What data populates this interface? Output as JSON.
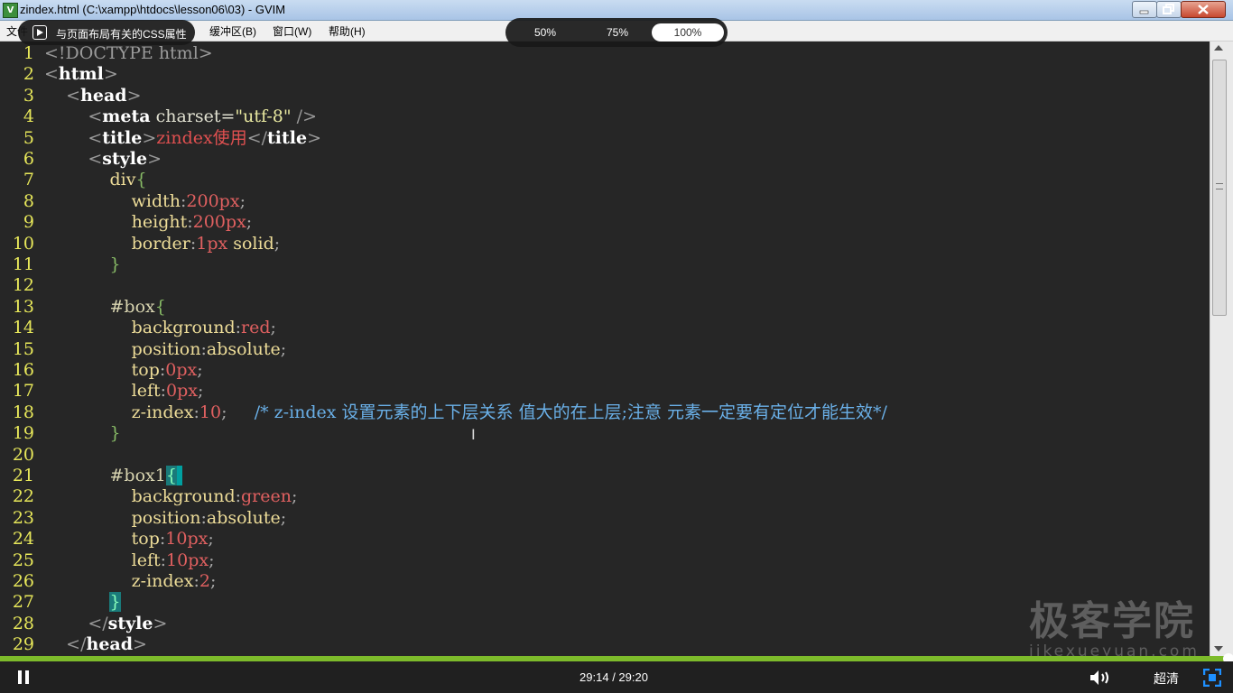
{
  "window": {
    "title": "zindex.html (C:\\xampp\\htdocs\\lesson06\\03) - GVIM",
    "app_icon": "vim-icon"
  },
  "menubar": {
    "items": [
      {
        "label": "文件"
      },
      {
        "label": "缓冲区(B)"
      },
      {
        "label": "窗口(W)"
      },
      {
        "label": "帮助(H)"
      }
    ]
  },
  "overlay": {
    "chapter": {
      "label": "与页面布局有关的CSS属性",
      "icon": "play-icon"
    },
    "zoom": {
      "options": [
        "50%",
        "75%",
        "100%"
      ],
      "selected": "100%"
    }
  },
  "editor": {
    "lines": [
      {
        "n": "1",
        "tokens": [
          [
            "<",
            "t-br"
          ],
          [
            "!DOCTYPE html",
            "t-br"
          ],
          [
            ">",
            "t-br"
          ]
        ]
      },
      {
        "n": "2",
        "tokens": [
          [
            "<",
            "t-br"
          ],
          [
            "html",
            "t-tag"
          ],
          [
            ">",
            "t-br"
          ]
        ]
      },
      {
        "n": "3",
        "tokens": [
          [
            "    ",
            ""
          ],
          [
            "<",
            "t-br"
          ],
          [
            "head",
            "t-tag"
          ],
          [
            ">",
            "t-br"
          ]
        ]
      },
      {
        "n": "4",
        "tokens": [
          [
            "        ",
            ""
          ],
          [
            "<",
            "t-br"
          ],
          [
            "meta",
            "t-tag"
          ],
          [
            " charset=",
            "t-attr"
          ],
          [
            "\"utf-8\"",
            "t-str"
          ],
          [
            " />",
            "t-br"
          ]
        ]
      },
      {
        "n": "5",
        "tokens": [
          [
            "        ",
            ""
          ],
          [
            "<",
            "t-br"
          ],
          [
            "title",
            "t-tag"
          ],
          [
            ">",
            "t-br"
          ],
          [
            "zindex使用",
            "t-title"
          ],
          [
            "</",
            "t-br"
          ],
          [
            "title",
            "t-tag"
          ],
          [
            ">",
            "t-br"
          ]
        ]
      },
      {
        "n": "6",
        "tokens": [
          [
            "        ",
            ""
          ],
          [
            "<",
            "t-br"
          ],
          [
            "style",
            "t-tag"
          ],
          [
            ">",
            "t-br"
          ]
        ]
      },
      {
        "n": "7",
        "tokens": [
          [
            "            ",
            ""
          ],
          [
            "div",
            "t-prop"
          ],
          [
            "{",
            "t-brace"
          ]
        ]
      },
      {
        "n": "8",
        "tokens": [
          [
            "                ",
            ""
          ],
          [
            "width",
            "t-prop"
          ],
          [
            ":",
            "t-punc"
          ],
          [
            "200px",
            "t-val"
          ],
          [
            ";",
            "t-punc"
          ]
        ]
      },
      {
        "n": "9",
        "tokens": [
          [
            "                ",
            ""
          ],
          [
            "height",
            "t-prop"
          ],
          [
            ":",
            "t-punc"
          ],
          [
            "200px",
            "t-val"
          ],
          [
            ";",
            "t-punc"
          ]
        ]
      },
      {
        "n": "10",
        "tokens": [
          [
            "                ",
            ""
          ],
          [
            "border",
            "t-prop"
          ],
          [
            ":",
            "t-punc"
          ],
          [
            "1px",
            "t-val"
          ],
          [
            " solid",
            "t-prop"
          ],
          [
            ";",
            "t-punc"
          ]
        ]
      },
      {
        "n": "11",
        "tokens": [
          [
            "            ",
            ""
          ],
          [
            "}",
            "t-brace"
          ]
        ]
      },
      {
        "n": "12",
        "tokens": []
      },
      {
        "n": "13",
        "tokens": [
          [
            "            ",
            ""
          ],
          [
            "#box",
            "t-sel"
          ],
          [
            "{",
            "t-brace"
          ]
        ]
      },
      {
        "n": "14",
        "tokens": [
          [
            "                ",
            ""
          ],
          [
            "background",
            "t-prop"
          ],
          [
            ":",
            "t-punc"
          ],
          [
            "red",
            "t-val"
          ],
          [
            ";",
            "t-punc"
          ]
        ]
      },
      {
        "n": "15",
        "tokens": [
          [
            "                ",
            ""
          ],
          [
            "position",
            "t-prop"
          ],
          [
            ":",
            "t-punc"
          ],
          [
            "absolute",
            "t-prop"
          ],
          [
            ";",
            "t-punc"
          ]
        ]
      },
      {
        "n": "16",
        "tokens": [
          [
            "                ",
            ""
          ],
          [
            "top",
            "t-prop"
          ],
          [
            ":",
            "t-punc"
          ],
          [
            "0px",
            "t-val"
          ],
          [
            ";",
            "t-punc"
          ]
        ]
      },
      {
        "n": "17",
        "tokens": [
          [
            "                ",
            ""
          ],
          [
            "left",
            "t-prop"
          ],
          [
            ":",
            "t-punc"
          ],
          [
            "0px",
            "t-val"
          ],
          [
            ";",
            "t-punc"
          ]
        ]
      },
      {
        "n": "18",
        "tokens": [
          [
            "                ",
            ""
          ],
          [
            "z-index",
            "t-prop"
          ],
          [
            ":",
            "t-punc"
          ],
          [
            "10",
            "t-val"
          ],
          [
            ";",
            "t-punc"
          ],
          [
            "     /* z-index 设置元素的上下层关系 值大的在上层;注意 元素一定要有定位才能生效*/",
            "t-comment"
          ]
        ]
      },
      {
        "n": "19",
        "tokens": [
          [
            "            ",
            ""
          ],
          [
            "}",
            "t-brace"
          ]
        ]
      },
      {
        "n": "20",
        "tokens": []
      },
      {
        "n": "21",
        "tokens": [
          [
            "            ",
            ""
          ],
          [
            "#box1",
            "t-sel"
          ],
          [
            "{",
            "t-match"
          ],
          [
            "|",
            "t-cur"
          ]
        ]
      },
      {
        "n": "22",
        "tokens": [
          [
            "                ",
            ""
          ],
          [
            "background",
            "t-prop"
          ],
          [
            ":",
            "t-punc"
          ],
          [
            "green",
            "t-val"
          ],
          [
            ";",
            "t-punc"
          ]
        ]
      },
      {
        "n": "23",
        "tokens": [
          [
            "                ",
            ""
          ],
          [
            "position",
            "t-prop"
          ],
          [
            ":",
            "t-punc"
          ],
          [
            "absolute",
            "t-prop"
          ],
          [
            ";",
            "t-punc"
          ]
        ]
      },
      {
        "n": "24",
        "tokens": [
          [
            "                ",
            ""
          ],
          [
            "top",
            "t-prop"
          ],
          [
            ":",
            "t-punc"
          ],
          [
            "10px",
            "t-val"
          ],
          [
            ";",
            "t-punc"
          ]
        ]
      },
      {
        "n": "25",
        "tokens": [
          [
            "                ",
            ""
          ],
          [
            "left",
            "t-prop"
          ],
          [
            ":",
            "t-punc"
          ],
          [
            "10px",
            "t-val"
          ],
          [
            ";",
            "t-punc"
          ]
        ]
      },
      {
        "n": "26",
        "tokens": [
          [
            "                ",
            ""
          ],
          [
            "z-index",
            "t-prop"
          ],
          [
            ":",
            "t-punc"
          ],
          [
            "2",
            "t-val"
          ],
          [
            ";",
            "t-punc"
          ]
        ]
      },
      {
        "n": "27",
        "tokens": [
          [
            "            ",
            ""
          ],
          [
            "}",
            "t-match"
          ]
        ]
      },
      {
        "n": "28",
        "tokens": [
          [
            "        ",
            ""
          ],
          [
            "</",
            "t-br"
          ],
          [
            "style",
            "t-tag"
          ],
          [
            ">",
            "t-br"
          ]
        ]
      },
      {
        "n": "29",
        "tokens": [
          [
            "    ",
            ""
          ],
          [
            "</",
            "t-br"
          ],
          [
            "head",
            "t-tag"
          ],
          [
            ">",
            "t-br"
          ]
        ]
      }
    ]
  },
  "watermark": {
    "title": "极客学院",
    "subtitle": "jikexueyuan.com"
  },
  "player": {
    "time": "29:14 / 29:20",
    "progress": 0.9966,
    "quality": "超清",
    "pause_icon": "pause-icon",
    "volume_icon": "volume-icon",
    "fullscreen_icon": "fullscreen-icon"
  },
  "colors": {
    "progress": "#7dbb2b",
    "editor_bg": "#262626",
    "line_number": "#e8e85a"
  }
}
